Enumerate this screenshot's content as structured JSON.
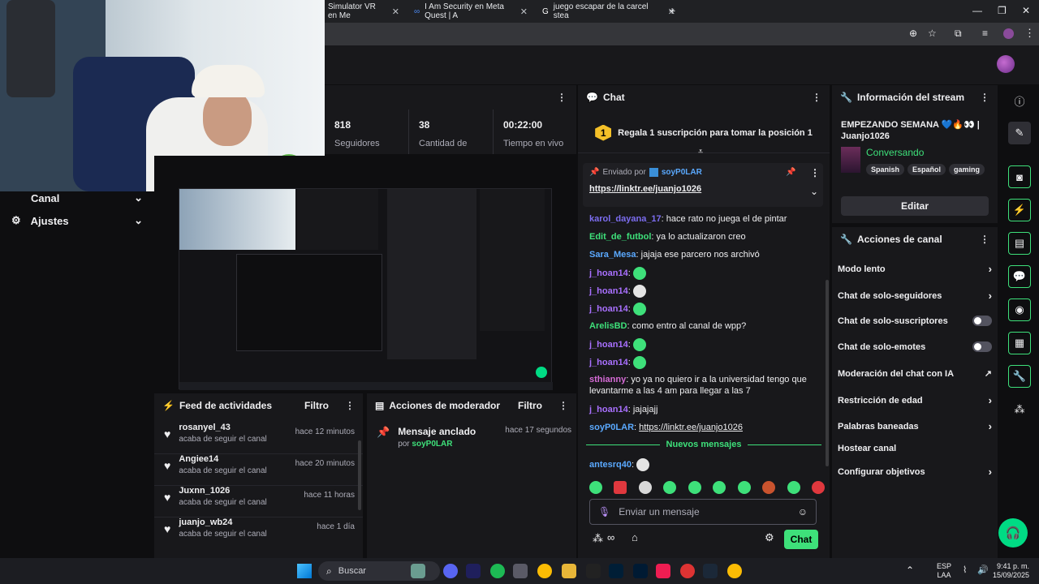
{
  "browser": {
    "tabs": [
      {
        "title": "Simulator VR en Me",
        "favicon": "tab-icon"
      },
      {
        "title": "I Am Security en Meta Quest | A",
        "favicon": "meta-icon"
      },
      {
        "title": "juego escapar de la carcel stea",
        "favicon": "google-icon"
      }
    ]
  },
  "stats": [
    {
      "value": "818",
      "label": "Seguidores"
    },
    {
      "value": "38",
      "label": "Cantidad de"
    },
    {
      "value": "00:22:00",
      "label": "Tiempo en vivo"
    }
  ],
  "sidebar": {
    "items": [
      {
        "label": "Canal"
      },
      {
        "label": "Ajustes"
      }
    ]
  },
  "activity": {
    "title": "Feed de actividades",
    "filter": "Filtro",
    "items": [
      {
        "name": "rosanyel_43",
        "action": "acaba de seguir el canal",
        "time": "hace 12 minutos"
      },
      {
        "name": "Angiee14",
        "action": "acaba de seguir el canal",
        "time": "hace 20 minutos"
      },
      {
        "name": "Juxnn_1026",
        "action": "acaba de seguir el canal",
        "time": "hace 11 horas"
      },
      {
        "name": "juanjo_wb24",
        "action": "acaba de seguir el canal",
        "time": "hace 1 día"
      }
    ]
  },
  "modactions": {
    "title": "Acciones de moderador",
    "filter": "Filtro",
    "item_title": "Mensaje anclado",
    "item_by_prefix": "por",
    "item_by_user": "soyP0LAR",
    "item_time": "hace 17 segundos"
  },
  "chat": {
    "title": "Chat",
    "hype_rank": "1",
    "hype_text": "Regala 1 suscripción para tomar la posición 1",
    "pinned_by_label": "Enviado por",
    "pinned_by_user": "soyP0LAR",
    "pinned_link": "https://linktr.ee/juanjo1026",
    "messages": [
      {
        "user": "karol_dayana_17",
        "text": "hace rato no juega el de pintar",
        "color": "#7c6df0"
      },
      {
        "user": "Edit_de_futbol",
        "text": "ya lo actualizaron creo",
        "color": "#3ee07a"
      },
      {
        "user": "Sara_Mesa",
        "text": "jajaja ese parcero nos archivó",
        "color": "#5aa9ff"
      },
      {
        "user": "j_hoan14",
        "text": "",
        "color": "#a970ff"
      },
      {
        "user": "j_hoan14",
        "text": "",
        "color": "#a970ff"
      },
      {
        "user": "j_hoan14",
        "text": "",
        "color": "#a970ff"
      },
      {
        "user": "ArelisBD",
        "text": "como entro al canal de wpp?",
        "color": "#3ee07a"
      },
      {
        "user": "j_hoan14",
        "text": "",
        "color": "#a970ff"
      },
      {
        "user": "j_hoan14",
        "text": "",
        "color": "#a970ff"
      },
      {
        "user": "sthianny",
        "text": "yo ya no quiero ir a la universidad tengo que levantarme a las 4 am para llegar a las 7",
        "color": "#d66bd6"
      },
      {
        "user": "j_hoan14",
        "text": "jajajajj",
        "color": "#a970ff"
      },
      {
        "user": "soyP0LAR",
        "text": "https://linktr.ee/juanjo1026",
        "color": "#5aa9ff"
      }
    ],
    "new_messages": "Nuevos mensajes",
    "last_user": "antesrq40",
    "input_placeholder": "Enviar un mensaje",
    "send_label": "Chat"
  },
  "stream_info": {
    "title": "Información del stream",
    "stream_title": "EMPEZANDO SEMANA 💙🔥👀 | Juanjo1026",
    "category": "Conversando",
    "tags": [
      "Spanish",
      "Español",
      "gaming"
    ],
    "edit_label": "Editar"
  },
  "channel_actions": {
    "title": "Acciones de canal",
    "items": [
      {
        "label": "Modo lento",
        "kind": "chevron"
      },
      {
        "label": "Chat de solo-seguidores",
        "kind": "chevron"
      },
      {
        "label": "Chat de solo-suscriptores",
        "kind": "toggle"
      },
      {
        "label": "Chat de solo-emotes",
        "kind": "toggle"
      },
      {
        "label": "Moderación del chat con IA",
        "kind": "external"
      },
      {
        "label": "Restricción de edad",
        "kind": "chevron"
      },
      {
        "label": "Palabras baneadas",
        "kind": "chevron"
      },
      {
        "label": "Hostear canal",
        "kind": "none"
      },
      {
        "label": "Configurar objetivos",
        "kind": "chevron"
      }
    ]
  },
  "taskbar": {
    "search_placeholder": "Buscar",
    "lang_top": "ESP",
    "lang_bottom": "LAA",
    "time": "9:41 p. m.",
    "date": "15/09/2025"
  },
  "colors": {
    "accent": "#00db84",
    "twitch_purple": "#a970ff",
    "bg": "#0e0e10",
    "panel": "#18181b"
  }
}
